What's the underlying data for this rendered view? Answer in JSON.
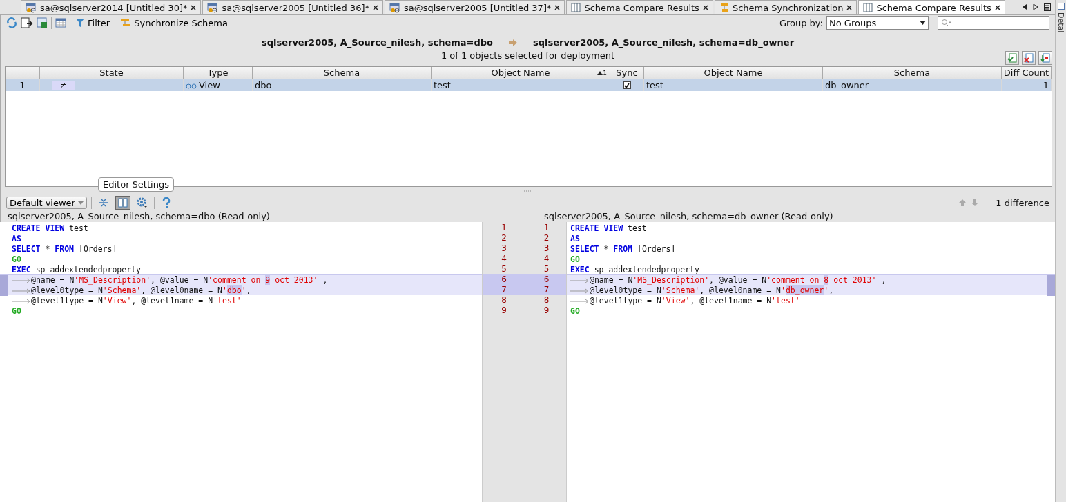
{
  "tabs": [
    {
      "label": "sa@sqlserver2014 [Untitled 30]*",
      "kind": "query",
      "selected": false
    },
    {
      "label": "sa@sqlserver2005 [Untitled 36]*",
      "kind": "query",
      "selected": false
    },
    {
      "label": "sa@sqlserver2005 [Untitled 37]*",
      "kind": "query",
      "selected": false
    },
    {
      "label": "Schema Compare Results",
      "kind": "compare",
      "selected": false
    },
    {
      "label": "Schema Synchronization",
      "kind": "sync",
      "selected": false
    },
    {
      "label": "Schema Compare Results",
      "kind": "compare",
      "selected": true
    }
  ],
  "toolbar": {
    "filter": "Filter",
    "synchronize": "Synchronize Schema",
    "group_by_label": "Group by:",
    "group_by_value": "No Groups"
  },
  "comparison": {
    "source": "sqlserver2005, A_Source_nilesh,  schema=dbo",
    "target": "sqlserver2005, A_Source_nilesh,  schema=db_owner",
    "status": "1 of 1 objects selected for deployment"
  },
  "table": {
    "columns": [
      {
        "label": "State"
      },
      {
        "label": "Type"
      },
      {
        "label": "Schema"
      },
      {
        "label": "Object Name",
        "sort": "1"
      },
      {
        "label": "Sync"
      },
      {
        "label": "Object Name"
      },
      {
        "label": "Schema"
      },
      {
        "label": "Diff Count"
      }
    ],
    "rows": [
      {
        "number": "1",
        "state": "≠",
        "type": "View",
        "source_schema": "dbo",
        "source_name": "test",
        "sync": true,
        "target_name": "test",
        "target_schema": "db_owner",
        "diff_count": "1",
        "selected": true
      }
    ]
  },
  "diff": {
    "viewer": "Default viewer",
    "tooltip": "Editor Settings",
    "count": "1 difference",
    "left_title": "sqlserver2005, A_Source_nilesh, schema=dbo (Read-only)",
    "right_title": "sqlserver2005, A_Source_nilesh, schema=db_owner (Read-only)",
    "lines": [
      {
        "left_no": "1",
        "right_no": "1",
        "changed": false,
        "left": [
          {
            "kind": "kw",
            "text": "CREATE VIEW"
          },
          {
            "kind": "plain",
            "text": " test"
          }
        ],
        "right": [
          {
            "kind": "kw",
            "text": "CREATE VIEW"
          },
          {
            "kind": "plain",
            "text": " test"
          }
        ]
      },
      {
        "left_no": "2",
        "right_no": "2",
        "changed": false,
        "left": [
          {
            "kind": "kw",
            "text": "AS"
          }
        ],
        "right": [
          {
            "kind": "kw",
            "text": "AS"
          }
        ]
      },
      {
        "left_no": "3",
        "right_no": "3",
        "changed": false,
        "left": [
          {
            "kind": "kw",
            "text": "SELECT"
          },
          {
            "kind": "plain",
            "text": " * "
          },
          {
            "kind": "kw",
            "text": "FROM"
          },
          {
            "kind": "plain",
            "text": " [Orders]"
          }
        ],
        "right": [
          {
            "kind": "kw",
            "text": "SELECT"
          },
          {
            "kind": "plain",
            "text": " * "
          },
          {
            "kind": "kw",
            "text": "FROM"
          },
          {
            "kind": "plain",
            "text": " [Orders]"
          }
        ]
      },
      {
        "left_no": "4",
        "right_no": "4",
        "changed": false,
        "left": [
          {
            "kind": "go",
            "text": "GO"
          }
        ],
        "right": [
          {
            "kind": "go",
            "text": "GO"
          }
        ]
      },
      {
        "left_no": "5",
        "right_no": "5",
        "changed": false,
        "left": [
          {
            "kind": "kw",
            "text": "EXEC"
          },
          {
            "kind": "plain",
            "text": " sp_addextendedproperty"
          }
        ],
        "right": [
          {
            "kind": "kw",
            "text": "EXEC"
          },
          {
            "kind": "plain",
            "text": " sp_addextendedproperty"
          }
        ]
      },
      {
        "left_no": "6",
        "right_no": "6",
        "changed": true,
        "left": [
          {
            "kind": "tab"
          },
          {
            "kind": "plain",
            "text": "@name = N"
          },
          {
            "kind": "str",
            "text": "'MS_Description'"
          },
          {
            "kind": "plain",
            "text": ", @value = N"
          },
          {
            "kind": "str",
            "text": "'comment on "
          },
          {
            "kind": "diff",
            "text": "9"
          },
          {
            "kind": "str",
            "text": " oct 2013'"
          },
          {
            "kind": "plain",
            "text": " ,"
          }
        ],
        "right": [
          {
            "kind": "tab"
          },
          {
            "kind": "plain",
            "text": "@name = N"
          },
          {
            "kind": "str",
            "text": "'MS_Description'"
          },
          {
            "kind": "plain",
            "text": ", @value = N"
          },
          {
            "kind": "str",
            "text": "'comment on "
          },
          {
            "kind": "diff",
            "text": "8"
          },
          {
            "kind": "str",
            "text": " oct 2013'"
          },
          {
            "kind": "plain",
            "text": " ,"
          }
        ]
      },
      {
        "left_no": "7",
        "right_no": "7",
        "changed": true,
        "left": [
          {
            "kind": "tab"
          },
          {
            "kind": "plain",
            "text": "@level0type = N"
          },
          {
            "kind": "str",
            "text": "'Schema'"
          },
          {
            "kind": "plain",
            "text": ", @level0name = N"
          },
          {
            "kind": "str",
            "text": "'"
          },
          {
            "kind": "diff",
            "text": "dbo"
          },
          {
            "kind": "str",
            "text": "'"
          },
          {
            "kind": "plain",
            "text": ","
          }
        ],
        "right": [
          {
            "kind": "tab"
          },
          {
            "kind": "plain",
            "text": "@level0type = N"
          },
          {
            "kind": "str",
            "text": "'Schema'"
          },
          {
            "kind": "plain",
            "text": ", @level0name = N"
          },
          {
            "kind": "str",
            "text": "'"
          },
          {
            "kind": "diff",
            "text": "db_owner"
          },
          {
            "kind": "str",
            "text": "'"
          },
          {
            "kind": "plain",
            "text": ","
          }
        ]
      },
      {
        "left_no": "8",
        "right_no": "8",
        "changed": false,
        "left": [
          {
            "kind": "tab"
          },
          {
            "kind": "plain",
            "text": "@level1type = N"
          },
          {
            "kind": "str",
            "text": "'View'"
          },
          {
            "kind": "plain",
            "text": ", @level1name = N"
          },
          {
            "kind": "str",
            "text": "'test'"
          }
        ],
        "right": [
          {
            "kind": "tab"
          },
          {
            "kind": "plain",
            "text": "@level1type = N"
          },
          {
            "kind": "str",
            "text": "'View'"
          },
          {
            "kind": "plain",
            "text": ", @level1name = N"
          },
          {
            "kind": "str",
            "text": "'test'"
          }
        ]
      },
      {
        "left_no": "9",
        "right_no": "9",
        "changed": false,
        "left": [
          {
            "kind": "go",
            "text": "GO"
          }
        ],
        "right": [
          {
            "kind": "go",
            "text": "GO"
          }
        ]
      }
    ]
  },
  "detail_panel": {
    "label": "Detai"
  }
}
